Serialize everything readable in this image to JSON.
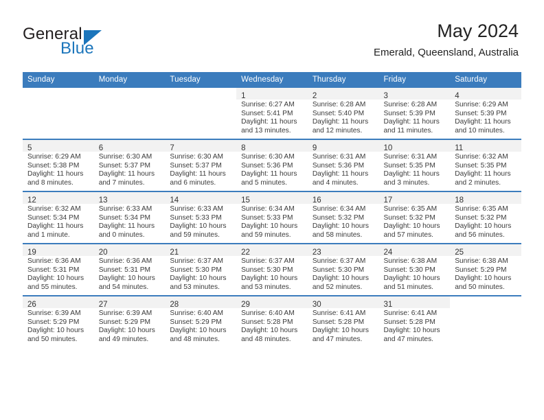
{
  "brand": {
    "name_part1": "General",
    "name_part2": "Blue",
    "logo_icon": "triangle-logo-icon",
    "color_blue": "#1b75bb",
    "color_dark": "#231f20"
  },
  "header": {
    "title": "May 2024",
    "subtitle": "Emerald, Queensland, Australia"
  },
  "calendar": {
    "accent_color": "#3b7cbd",
    "daynum_band_color": "#f2f2f2",
    "weekdays": [
      "Sunday",
      "Monday",
      "Tuesday",
      "Wednesday",
      "Thursday",
      "Friday",
      "Saturday"
    ],
    "labels": {
      "sunrise": "Sunrise:",
      "sunset": "Sunset:",
      "daylight": "Daylight:"
    },
    "weeks": [
      [
        {
          "day": "",
          "empty": true
        },
        {
          "day": "",
          "empty": true
        },
        {
          "day": "",
          "empty": true
        },
        {
          "day": "1",
          "sunrise": "Sunrise: 6:27 AM",
          "sunset": "Sunset: 5:41 PM",
          "daylight_line1": "Daylight: 11 hours",
          "daylight_line2": "and 13 minutes."
        },
        {
          "day": "2",
          "sunrise": "Sunrise: 6:28 AM",
          "sunset": "Sunset: 5:40 PM",
          "daylight_line1": "Daylight: 11 hours",
          "daylight_line2": "and 12 minutes."
        },
        {
          "day": "3",
          "sunrise": "Sunrise: 6:28 AM",
          "sunset": "Sunset: 5:39 PM",
          "daylight_line1": "Daylight: 11 hours",
          "daylight_line2": "and 11 minutes."
        },
        {
          "day": "4",
          "sunrise": "Sunrise: 6:29 AM",
          "sunset": "Sunset: 5:39 PM",
          "daylight_line1": "Daylight: 11 hours",
          "daylight_line2": "and 10 minutes."
        }
      ],
      [
        {
          "day": "5",
          "sunrise": "Sunrise: 6:29 AM",
          "sunset": "Sunset: 5:38 PM",
          "daylight_line1": "Daylight: 11 hours",
          "daylight_line2": "and 8 minutes."
        },
        {
          "day": "6",
          "sunrise": "Sunrise: 6:30 AM",
          "sunset": "Sunset: 5:37 PM",
          "daylight_line1": "Daylight: 11 hours",
          "daylight_line2": "and 7 minutes."
        },
        {
          "day": "7",
          "sunrise": "Sunrise: 6:30 AM",
          "sunset": "Sunset: 5:37 PM",
          "daylight_line1": "Daylight: 11 hours",
          "daylight_line2": "and 6 minutes."
        },
        {
          "day": "8",
          "sunrise": "Sunrise: 6:30 AM",
          "sunset": "Sunset: 5:36 PM",
          "daylight_line1": "Daylight: 11 hours",
          "daylight_line2": "and 5 minutes."
        },
        {
          "day": "9",
          "sunrise": "Sunrise: 6:31 AM",
          "sunset": "Sunset: 5:36 PM",
          "daylight_line1": "Daylight: 11 hours",
          "daylight_line2": "and 4 minutes."
        },
        {
          "day": "10",
          "sunrise": "Sunrise: 6:31 AM",
          "sunset": "Sunset: 5:35 PM",
          "daylight_line1": "Daylight: 11 hours",
          "daylight_line2": "and 3 minutes."
        },
        {
          "day": "11",
          "sunrise": "Sunrise: 6:32 AM",
          "sunset": "Sunset: 5:35 PM",
          "daylight_line1": "Daylight: 11 hours",
          "daylight_line2": "and 2 minutes."
        }
      ],
      [
        {
          "day": "12",
          "sunrise": "Sunrise: 6:32 AM",
          "sunset": "Sunset: 5:34 PM",
          "daylight_line1": "Daylight: 11 hours",
          "daylight_line2": "and 1 minute."
        },
        {
          "day": "13",
          "sunrise": "Sunrise: 6:33 AM",
          "sunset": "Sunset: 5:34 PM",
          "daylight_line1": "Daylight: 11 hours",
          "daylight_line2": "and 0 minutes."
        },
        {
          "day": "14",
          "sunrise": "Sunrise: 6:33 AM",
          "sunset": "Sunset: 5:33 PM",
          "daylight_line1": "Daylight: 10 hours",
          "daylight_line2": "and 59 minutes."
        },
        {
          "day": "15",
          "sunrise": "Sunrise: 6:34 AM",
          "sunset": "Sunset: 5:33 PM",
          "daylight_line1": "Daylight: 10 hours",
          "daylight_line2": "and 59 minutes."
        },
        {
          "day": "16",
          "sunrise": "Sunrise: 6:34 AM",
          "sunset": "Sunset: 5:32 PM",
          "daylight_line1": "Daylight: 10 hours",
          "daylight_line2": "and 58 minutes."
        },
        {
          "day": "17",
          "sunrise": "Sunrise: 6:35 AM",
          "sunset": "Sunset: 5:32 PM",
          "daylight_line1": "Daylight: 10 hours",
          "daylight_line2": "and 57 minutes."
        },
        {
          "day": "18",
          "sunrise": "Sunrise: 6:35 AM",
          "sunset": "Sunset: 5:32 PM",
          "daylight_line1": "Daylight: 10 hours",
          "daylight_line2": "and 56 minutes."
        }
      ],
      [
        {
          "day": "19",
          "sunrise": "Sunrise: 6:36 AM",
          "sunset": "Sunset: 5:31 PM",
          "daylight_line1": "Daylight: 10 hours",
          "daylight_line2": "and 55 minutes."
        },
        {
          "day": "20",
          "sunrise": "Sunrise: 6:36 AM",
          "sunset": "Sunset: 5:31 PM",
          "daylight_line1": "Daylight: 10 hours",
          "daylight_line2": "and 54 minutes."
        },
        {
          "day": "21",
          "sunrise": "Sunrise: 6:37 AM",
          "sunset": "Sunset: 5:30 PM",
          "daylight_line1": "Daylight: 10 hours",
          "daylight_line2": "and 53 minutes."
        },
        {
          "day": "22",
          "sunrise": "Sunrise: 6:37 AM",
          "sunset": "Sunset: 5:30 PM",
          "daylight_line1": "Daylight: 10 hours",
          "daylight_line2": "and 53 minutes."
        },
        {
          "day": "23",
          "sunrise": "Sunrise: 6:37 AM",
          "sunset": "Sunset: 5:30 PM",
          "daylight_line1": "Daylight: 10 hours",
          "daylight_line2": "and 52 minutes."
        },
        {
          "day": "24",
          "sunrise": "Sunrise: 6:38 AM",
          "sunset": "Sunset: 5:30 PM",
          "daylight_line1": "Daylight: 10 hours",
          "daylight_line2": "and 51 minutes."
        },
        {
          "day": "25",
          "sunrise": "Sunrise: 6:38 AM",
          "sunset": "Sunset: 5:29 PM",
          "daylight_line1": "Daylight: 10 hours",
          "daylight_line2": "and 50 minutes."
        }
      ],
      [
        {
          "day": "26",
          "sunrise": "Sunrise: 6:39 AM",
          "sunset": "Sunset: 5:29 PM",
          "daylight_line1": "Daylight: 10 hours",
          "daylight_line2": "and 50 minutes."
        },
        {
          "day": "27",
          "sunrise": "Sunrise: 6:39 AM",
          "sunset": "Sunset: 5:29 PM",
          "daylight_line1": "Daylight: 10 hours",
          "daylight_line2": "and 49 minutes."
        },
        {
          "day": "28",
          "sunrise": "Sunrise: 6:40 AM",
          "sunset": "Sunset: 5:29 PM",
          "daylight_line1": "Daylight: 10 hours",
          "daylight_line2": "and 48 minutes."
        },
        {
          "day": "29",
          "sunrise": "Sunrise: 6:40 AM",
          "sunset": "Sunset: 5:28 PM",
          "daylight_line1": "Daylight: 10 hours",
          "daylight_line2": "and 48 minutes."
        },
        {
          "day": "30",
          "sunrise": "Sunrise: 6:41 AM",
          "sunset": "Sunset: 5:28 PM",
          "daylight_line1": "Daylight: 10 hours",
          "daylight_line2": "and 47 minutes."
        },
        {
          "day": "31",
          "sunrise": "Sunrise: 6:41 AM",
          "sunset": "Sunset: 5:28 PM",
          "daylight_line1": "Daylight: 10 hours",
          "daylight_line2": "and 47 minutes."
        },
        {
          "day": "",
          "empty": true,
          "no_band": true
        }
      ]
    ]
  }
}
